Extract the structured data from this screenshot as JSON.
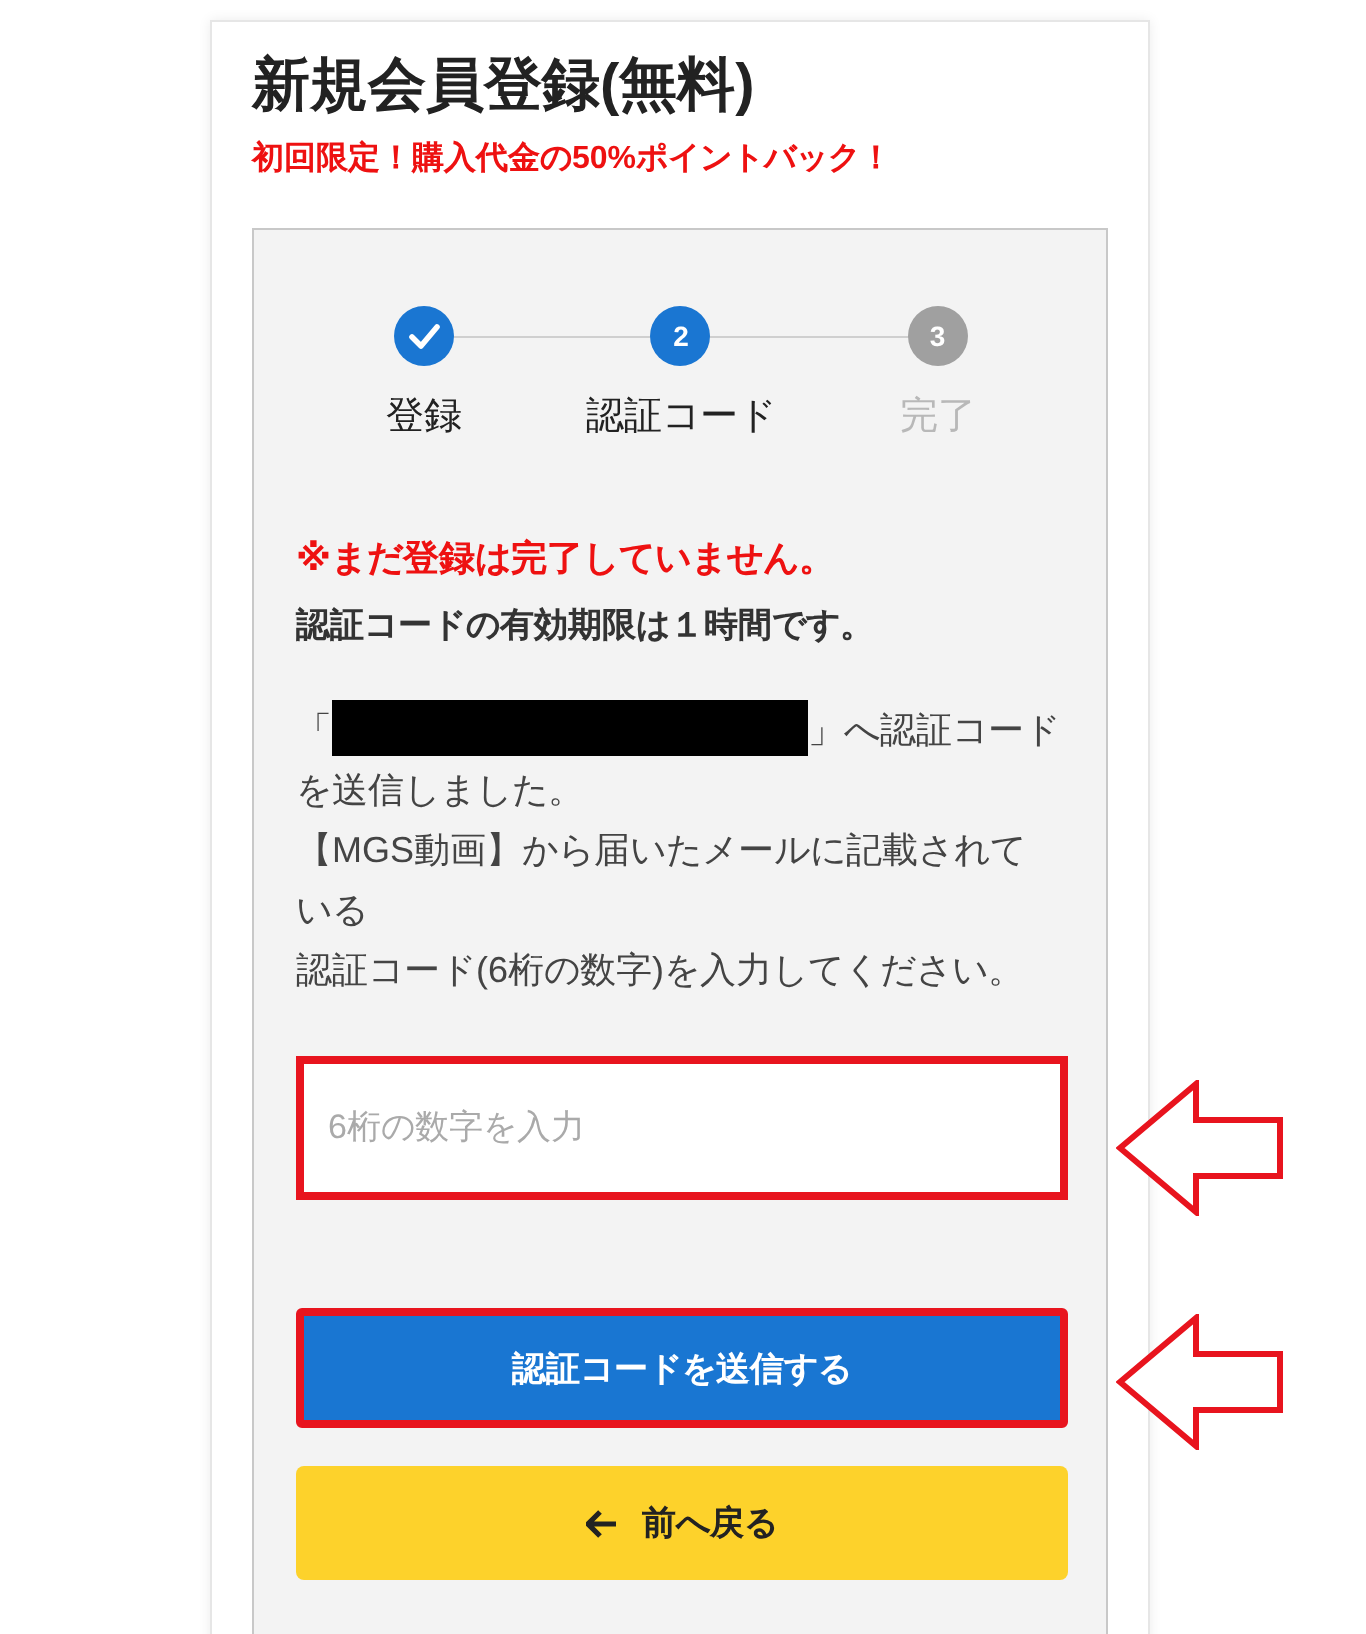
{
  "title": "新規会員登録(無料)",
  "promo": "初回限定！購入代金の50%ポイントバック！",
  "steps": [
    {
      "label": "登録",
      "kind": "done"
    },
    {
      "number": "2",
      "label": "認証コード",
      "kind": "current"
    },
    {
      "number": "3",
      "label": "完了",
      "kind": "pending"
    }
  ],
  "notice": "※まだ登録は完了していません。",
  "validity": "認証コードの有効期限は１時間です。",
  "message": {
    "before": "「",
    "after": "」へ認証コードを送信しました。",
    "redacted": true
  },
  "lines": [
    "【MGS動画】から届いたメールに記載されている",
    "認証コード(6桁の数字)を入力してください。"
  ],
  "code_input": {
    "placeholder": "6桁の数字を入力",
    "annotated": true
  },
  "submit_button": {
    "label": "認証コードを送信する",
    "annotated": true
  },
  "back_button": {
    "label": "前へ戻る"
  }
}
